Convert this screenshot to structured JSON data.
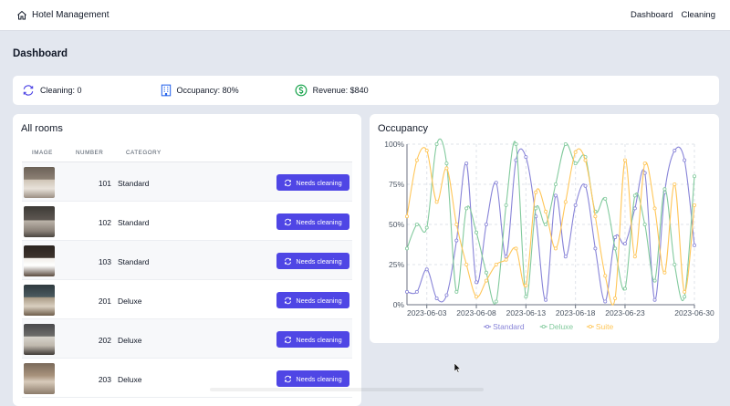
{
  "app": {
    "title": "Hotel Management"
  },
  "nav": {
    "items": [
      "Dashboard",
      "Cleaning"
    ]
  },
  "page": {
    "title": "Dashboard"
  },
  "stats": {
    "cleaning": "Cleaning: 0",
    "occupancy": "Occupancy: 80%",
    "revenue": "Revenue: $840"
  },
  "rooms": {
    "title": "All rooms",
    "columns": [
      "IMAGE",
      "NUMBER",
      "CATEGORY"
    ],
    "rows": [
      {
        "number": "101",
        "category": "Standard",
        "action": "Needs cleaning"
      },
      {
        "number": "102",
        "category": "Standard",
        "action": "Needs cleaning"
      },
      {
        "number": "103",
        "category": "Standard",
        "action": "Needs cleaning"
      },
      {
        "number": "201",
        "category": "Deluxe",
        "action": "Needs cleaning"
      },
      {
        "number": "202",
        "category": "Deluxe",
        "action": "Needs cleaning"
      },
      {
        "number": "203",
        "category": "Deluxe",
        "action": "Needs cleaning"
      }
    ]
  },
  "colors": {
    "accent": "#4f46e5",
    "standard": "#8884d8",
    "deluxe": "#82ca9d",
    "suite": "#ffc658"
  },
  "chart_data": {
    "type": "line",
    "title": "Occupancy",
    "x": [
      "2023-06-01",
      "2023-06-02",
      "2023-06-03",
      "2023-06-04",
      "2023-06-05",
      "2023-06-06",
      "2023-06-07",
      "2023-06-08",
      "2023-06-09",
      "2023-06-10",
      "2023-06-11",
      "2023-06-12",
      "2023-06-13",
      "2023-06-14",
      "2023-06-15",
      "2023-06-16",
      "2023-06-17",
      "2023-06-18",
      "2023-06-19",
      "2023-06-20",
      "2023-06-21",
      "2023-06-22",
      "2023-06-23",
      "2023-06-24",
      "2023-06-25",
      "2023-06-26",
      "2023-06-27",
      "2023-06-28",
      "2023-06-29",
      "2023-06-30"
    ],
    "x_ticks": [
      "2023-06-03",
      "2023-06-08",
      "2023-06-13",
      "2023-06-18",
      "2023-06-23",
      "2023-06-30"
    ],
    "y_ticks": [
      "0%",
      "25%",
      "50%",
      "75%",
      "100%"
    ],
    "ylim": [
      0,
      100
    ],
    "series": [
      {
        "name": "Standard",
        "values": [
          8,
          8,
          22,
          4,
          6,
          40,
          88,
          14,
          50,
          76,
          30,
          90,
          92,
          55,
          3,
          68,
          30,
          62,
          74,
          35,
          2,
          42,
          38,
          60,
          82,
          3,
          70,
          96,
          90,
          37
        ]
      },
      {
        "name": "Deluxe",
        "values": [
          35,
          50,
          48,
          100,
          88,
          8,
          60,
          45,
          20,
          2,
          62,
          100,
          5,
          60,
          50,
          75,
          100,
          88,
          92,
          58,
          66,
          35,
          10,
          68,
          50,
          15,
          72,
          25,
          5,
          80
        ]
      },
      {
        "name": "Suite",
        "values": [
          55,
          90,
          96,
          64,
          85,
          50,
          25,
          5,
          15,
          25,
          28,
          35,
          12,
          70,
          58,
          35,
          64,
          95,
          90,
          55,
          18,
          4,
          90,
          30,
          88,
          60,
          20,
          75,
          8,
          62
        ]
      }
    ],
    "grid": true,
    "legend": "bottom"
  }
}
